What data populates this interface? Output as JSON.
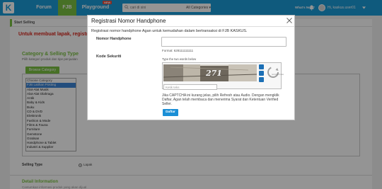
{
  "nav": {
    "logo": "K",
    "forum": "Forum",
    "fjb": "FJB",
    "playground": "Playground",
    "new_badge": "NEW",
    "search_placeholder": "cari di sini",
    "search_category": "All Categories",
    "whats_new": "What's New?",
    "user": "Hi, kaskus.user01"
  },
  "page": {
    "start_selling": "Start Selling",
    "alert": "Untuk membuat lapak, registrasi",
    "category_title": "Category & Selling Type",
    "category_sub": "Pilih kategori produk dan tipe penjualan",
    "browse_btn": "Browse Category",
    "categories": [
      "Choose Category",
      "FJB Latihan Posting",
      "Alat-Alat Musik",
      "Alat-Alat Olahraga",
      "Antik",
      "Baby & Kids",
      "Buku",
      "CD & DVD",
      "Elektronik",
      "Fashion & Mode",
      "Films & Fauna",
      "Furniture",
      "Gemstone",
      "Gratisan",
      "Handphone & Tablet",
      "Industri & Supplier"
    ],
    "selling_type_label": "Selling Type",
    "lapak": "Lapak",
    "detail_title": "Detail Information",
    "detail_sub": "Cantumkan informasi produk yang akan dijual"
  },
  "modal": {
    "title": "Registrasi Nomor Handphone",
    "desc": "Registrasi nomor handphone Agan untuk kemudahan dalam bertransaksi di FJB KASKUS.",
    "phone_label": "Nomor Handphone",
    "phone_value": "",
    "format": "Format: 628111111111",
    "captcha_label": "Kode Sekuriti",
    "captcha_hint": "Type the two words below",
    "captcha_word": "271",
    "captcha_brand": "reCAPTCHA",
    "captcha_placeholder": "Ketik teks",
    "terms": "Jika CAPTCHA ini kurang jelas, pilih Refresh atau Audio. Dengan mengklik Daftar, Agan telah membaca dan menerima Syarat dan Ketentuan Verified Seller.",
    "submit": "Daftar"
  },
  "colors": {
    "brand_blue": "#1b9bd7",
    "fjb_green": "#7ac143",
    "alert_red": "#d9261c",
    "button_blue": "#1b8fd6"
  }
}
